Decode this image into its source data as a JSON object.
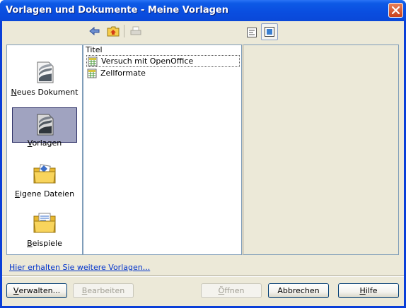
{
  "window": {
    "title": "Vorlagen und Dokumente - Meine Vorlagen"
  },
  "toolbar": {
    "icons": [
      "back-arrow-icon",
      "folder-up-icon",
      "print-icon",
      "document-properties-icon",
      "preview-icon"
    ]
  },
  "categories": [
    {
      "label_pre": "",
      "label_ul": "N",
      "label_post": "eues Dokument",
      "icon": "new-document-icon",
      "selected": false
    },
    {
      "label_pre": "",
      "label_ul": "V",
      "label_post": "orlagen",
      "icon": "templates-icon",
      "selected": true
    },
    {
      "label_pre": "",
      "label_ul": "E",
      "label_post": "igene Dateien",
      "icon": "my-documents-folder-icon",
      "selected": false
    },
    {
      "label_pre": "",
      "label_ul": "B",
      "label_post": "eispiele",
      "icon": "samples-folder-icon",
      "selected": false
    }
  ],
  "list": {
    "header": "Titel",
    "items": [
      {
        "title": "Versuch mit OpenOffice",
        "icon": "spreadsheet-template-icon"
      },
      {
        "title": "Zellformate",
        "icon": "spreadsheet-template-icon"
      }
    ]
  },
  "more_templates_link": "Hier erhalten Sie weitere Vorlagen...",
  "buttons": {
    "manage": {
      "ul": "V",
      "rest": "erwalten..."
    },
    "edit": {
      "ul": "B",
      "rest": "earbeiten"
    },
    "open": {
      "ul": "Ö",
      "rest": "ffnen"
    },
    "cancel": "Abbrechen",
    "help": {
      "ul": "H",
      "rest": "ilfe"
    }
  },
  "colors": {
    "titlebar": "#0a4ee0",
    "face": "#ece9d8",
    "selection": "#a0a3c0",
    "link": "#0033cc"
  }
}
